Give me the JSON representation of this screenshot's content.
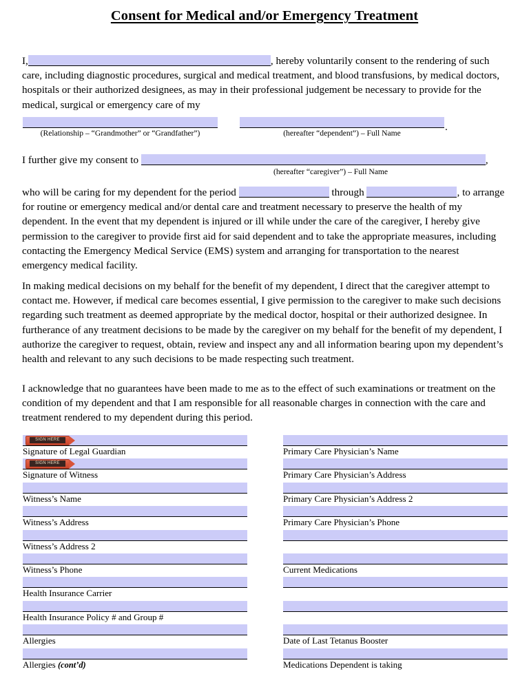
{
  "document": {
    "title": "Consent for Medical and/or Emergency Treatment"
  },
  "paragraphs": {
    "p1_pre": "I,",
    "p1_post": ", hereby voluntarily consent to the rendering of such care, including diagnostic procedures, surgical and medical treatment, and blood transfusions, by medical doctors, hospitals or their authorized designees, as may in their professional judgement be necessary to provide for the medical, surgical or emergency care of my",
    "p2_pre": "I further give my consent to",
    "p2_post": ",",
    "p3_pre": "who will be caring for my dependent for the period",
    "p3_mid": "through",
    "p3_post": ", to arrange for routine or emergency medical and/or dental care and treatment necessary to preserve the health of my dependent.  In the event that my dependent is injured or ill while under the care of the caregiver, I hereby give permission to the caregiver to provide first aid for said dependent and to take the appropriate measures, including contacting the Emergency Medical Service (EMS) system and arranging for transportation to the nearest emergency medical facility.",
    "p4": "In making medical decisions on my behalf for the benefit of my dependent, I direct that the caregiver attempt to contact me.  However, if medical care becomes essential, I give permission to the caregiver to make such decisions regarding such treatment as deemed appropriate by the medical doctor, hospital or their authorized designee.  In furtherance of any treatment decisions to be made by the caregiver on my behalf for the benefit of my dependent, I authorize the caregiver to request, obtain, review and inspect any and all information bearing upon my dependent’s health and relevant to any such decisions to be made respecting such treatment.",
    "p5": "I acknowledge that no guarantees have been made to me as to the effect of such examinations or treatment on the condition of my dependent and that I am responsible for all reasonable charges in connection with the care and treatment rendered to my dependent during this period."
  },
  "captions": {
    "relationship": "(Relationship – “Grandmother” or “Grandfather”)",
    "dependent": "(hereafter “dependent”) – Full Name",
    "caregiver": "(hereafter “caregiver”) – Full Name"
  },
  "sign_tag": {
    "label": "SIGN HERE"
  },
  "fields": {
    "left": [
      {
        "label": "Signature of Legal Guardian",
        "value": "",
        "sign_tag": true
      },
      {
        "label": "Signature of Witness",
        "value": "",
        "sign_tag": true
      },
      {
        "label": "Witness’s Name",
        "value": "",
        "sign_tag": false
      },
      {
        "label": "Witness’s Address",
        "value": "",
        "sign_tag": false
      },
      {
        "label": "Witness’s Address 2",
        "value": "",
        "sign_tag": false
      },
      {
        "label": "Witness’s Phone",
        "value": "",
        "sign_tag": false
      },
      {
        "label": "Health Insurance Carrier",
        "value": "",
        "sign_tag": false
      },
      {
        "label": "Health Insurance Policy # and Group #",
        "value": "",
        "sign_tag": false
      },
      {
        "label": "Allergies",
        "value": "",
        "sign_tag": false
      },
      {
        "label": "Allergies (cont’d)",
        "label_plain": "Allergies ",
        "label_italic": "(cont’d)",
        "value": "",
        "sign_tag": false
      }
    ],
    "right": [
      {
        "label": "Primary Care Physician’s Name",
        "value": ""
      },
      {
        "label": "Primary Care Physician’s Address",
        "value": ""
      },
      {
        "label": "Primary Care Physician’s Address 2",
        "value": ""
      },
      {
        "label": "Primary Care Physician’s Phone",
        "value": ""
      },
      {
        "label": "",
        "value": ""
      },
      {
        "label": "Current Medications",
        "value": ""
      },
      {
        "label": "",
        "value": ""
      },
      {
        "label": "",
        "value": ""
      },
      {
        "label": "Date of Last Tetanus Booster",
        "value": ""
      },
      {
        "label": "Medications Dependent is taking",
        "value": ""
      }
    ]
  },
  "colors": {
    "field_fill": "#ccccf8",
    "rule": "#000000",
    "sign_tag_red": "#d8543a",
    "paper": "#ffffff"
  }
}
